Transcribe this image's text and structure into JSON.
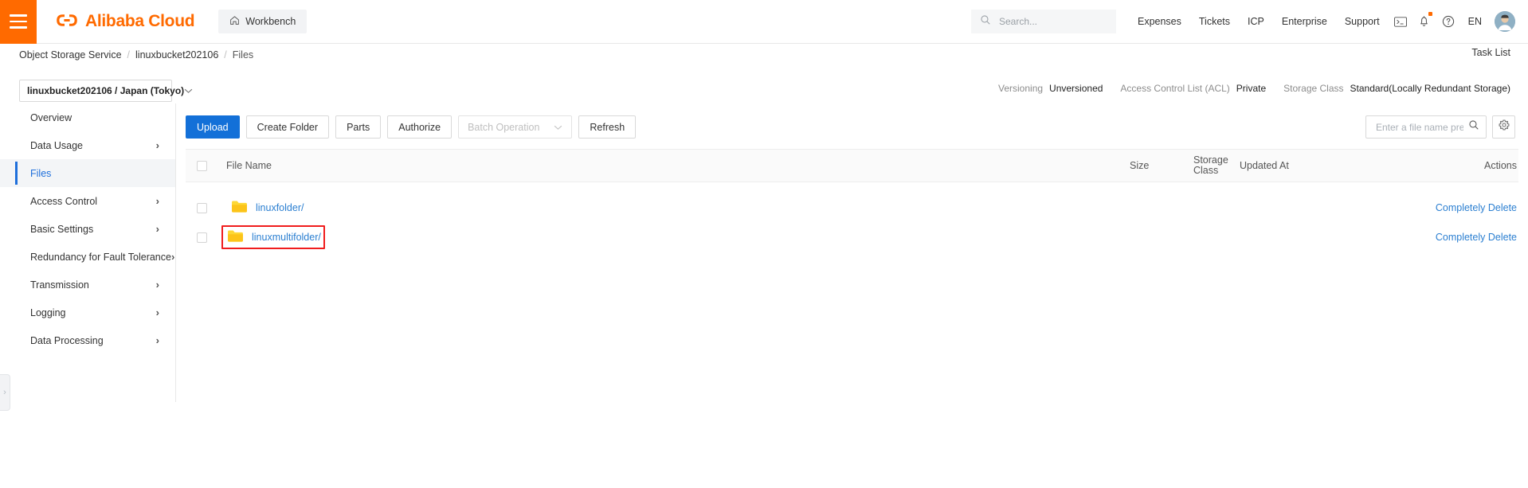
{
  "header": {
    "brand": "Alibaba Cloud",
    "brand_mark": "(-)",
    "workbench": "Workbench",
    "search_placeholder": "Search...",
    "search_value": "",
    "nav_links": [
      "Expenses",
      "Tickets",
      "ICP",
      "Enterprise",
      "Support"
    ],
    "icons": [
      "cloudshell-icon",
      "bell-icon",
      "help-icon"
    ],
    "language": "EN",
    "accent_color": "#ff6a00"
  },
  "breadcrumb": {
    "items": [
      "Object Storage Service",
      "linuxbucket202106",
      "Files"
    ],
    "separator": "/",
    "task_list": "Task List"
  },
  "bucket": {
    "selector_label": "linuxbucket202106 / Japan (Tokyo)",
    "meta": [
      {
        "key": "Versioning",
        "value": "Unversioned"
      },
      {
        "key": "Access Control List (ACL)",
        "value": "Private"
      },
      {
        "key": "Storage Class",
        "value": "Standard(Locally Redundant Storage)"
      }
    ]
  },
  "sidebar": {
    "items": [
      {
        "label": "Overview",
        "has_chevron": false,
        "active": false
      },
      {
        "label": "Data Usage",
        "has_chevron": true,
        "active": false
      },
      {
        "label": "Files",
        "has_chevron": false,
        "active": true
      },
      {
        "label": "Access Control",
        "has_chevron": true,
        "active": false
      },
      {
        "label": "Basic Settings",
        "has_chevron": true,
        "active": false
      },
      {
        "label": "Redundancy for Fault Tolerance",
        "has_chevron": true,
        "active": false
      },
      {
        "label": "Transmission",
        "has_chevron": true,
        "active": false
      },
      {
        "label": "Logging",
        "has_chevron": true,
        "active": false
      },
      {
        "label": "Data Processing",
        "has_chevron": true,
        "active": false
      }
    ],
    "collapse_handle": "›",
    "active_color": "#1e6fdb"
  },
  "toolbar": {
    "upload": "Upload",
    "create_folder": "Create Folder",
    "parts": "Parts",
    "authorize": "Authorize",
    "batch_operation": "Batch Operation",
    "refresh": "Refresh",
    "prefix_placeholder": "Enter a file name prefix",
    "prefix_value": "",
    "primary_color": "#1370d8"
  },
  "table": {
    "columns": [
      "File Name",
      "Size",
      "Storage Class",
      "Updated At",
      "Actions"
    ],
    "storage_class_line1": "Storage",
    "storage_class_line2": "Class",
    "rows": [
      {
        "name": "linuxfolder/",
        "size": "",
        "storage_class": "",
        "updated_at": "",
        "action": "Completely Delete",
        "highlighted": false
      },
      {
        "name": "linuxmultifolder/",
        "size": "",
        "storage_class": "",
        "updated_at": "",
        "action": "Completely Delete",
        "highlighted": true
      }
    ],
    "highlight_color": "#f01d1d",
    "link_color": "#2b7fd1",
    "folder_color": "#fbc02d"
  }
}
